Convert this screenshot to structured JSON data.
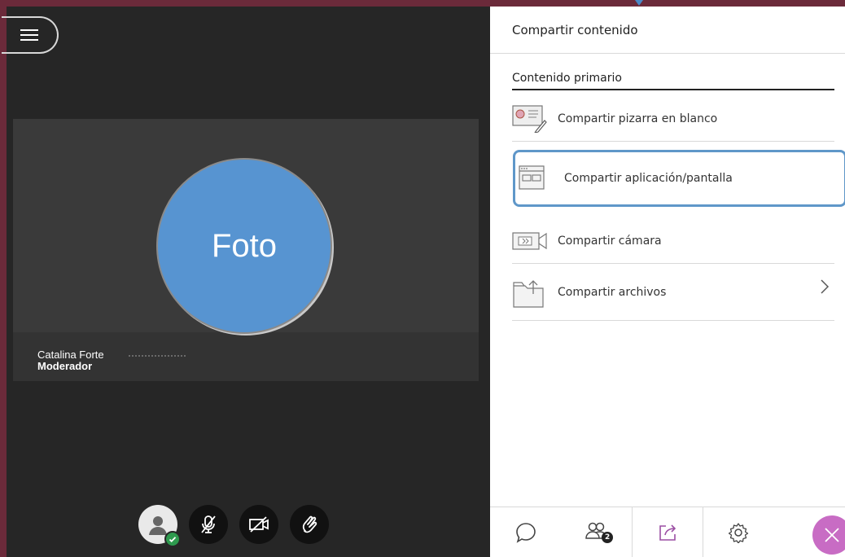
{
  "participant": {
    "photo_label": "Foto",
    "name": "Catalina Forte",
    "role": "Moderador"
  },
  "panel": {
    "title": "Compartir contenido",
    "section_title": "Contenido primario",
    "items": [
      {
        "label": "Compartir pizarra en blanco",
        "icon": "whiteboard-icon",
        "selected": false
      },
      {
        "label": "Compartir aplicación/pantalla",
        "icon": "screen-share-icon",
        "selected": true
      },
      {
        "label": "Compartir cámara",
        "icon": "camera-share-icon",
        "selected": false
      },
      {
        "label": "Compartir archivos",
        "icon": "folder-upload-icon",
        "selected": false,
        "has_submenu": true
      }
    ]
  },
  "tabs": [
    {
      "name": "chat",
      "icon": "chat-icon"
    },
    {
      "name": "attendees",
      "icon": "attendees-icon",
      "badge": "2"
    },
    {
      "name": "share-content",
      "icon": "share-content-icon",
      "active": true
    },
    {
      "name": "settings",
      "icon": "gear-icon"
    },
    {
      "name": "close",
      "icon": "close-icon"
    }
  ],
  "colors": {
    "frame": "#6b2a3a",
    "stage_background": "#262626",
    "photo_circle": "#5794d1",
    "selection_border": "#5f97c9",
    "status_green": "#2e9a4e",
    "close_button": "#c86cc4"
  }
}
